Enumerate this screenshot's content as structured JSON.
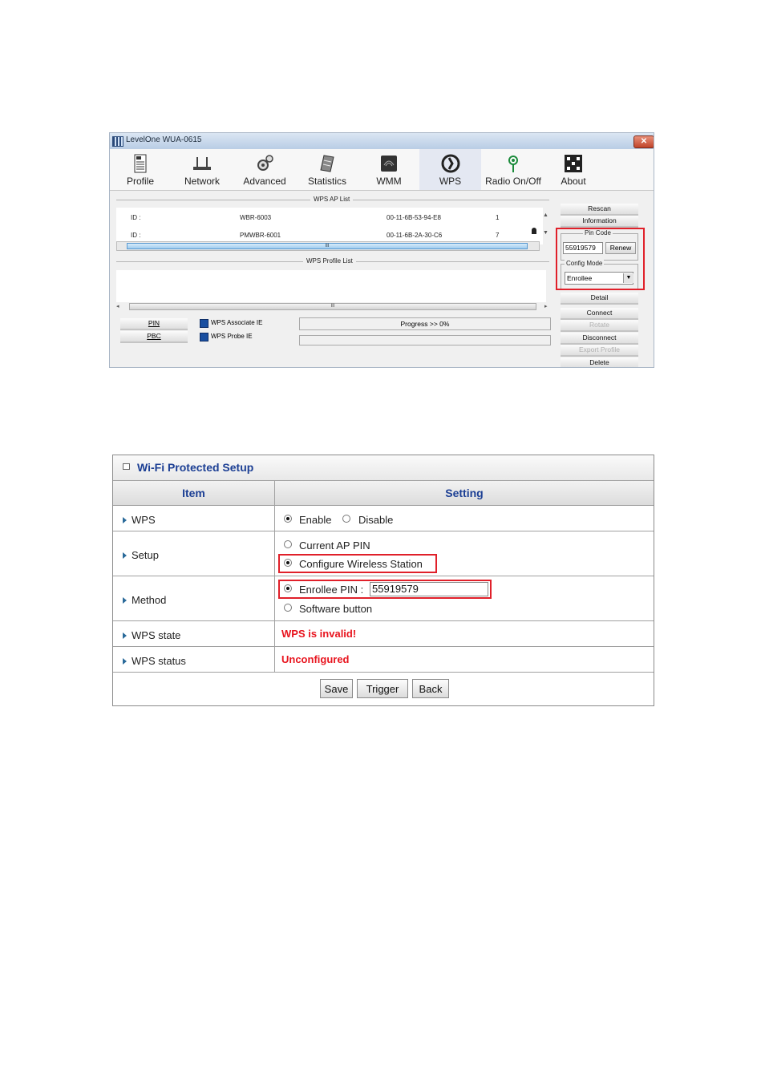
{
  "window": {
    "title": "LevelOne WUA-0615",
    "close_glyph": "✕"
  },
  "toolbar": [
    {
      "label": "Profile",
      "icon": "profile-icon"
    },
    {
      "label": "Network",
      "icon": "network-icon"
    },
    {
      "label": "Advanced",
      "icon": "advanced-icon"
    },
    {
      "label": "Statistics",
      "icon": "statistics-icon"
    },
    {
      "label": "WMM",
      "icon": "wmm-icon"
    },
    {
      "label": "WPS",
      "icon": "wps-icon"
    },
    {
      "label": "Radio On/Off",
      "icon": "radio-icon"
    },
    {
      "label": "About",
      "icon": "about-icon"
    }
  ],
  "ap_list": {
    "section_label": "WPS AP List",
    "rows": [
      {
        "id_label": "ID :",
        "ssid": "WBR-6003",
        "bssid": "00-11-6B-53-94-E8",
        "channel": "1"
      },
      {
        "id_label": "ID :",
        "ssid": "PMWBR-6001",
        "bssid": "00-11-6B-2A-30-C6",
        "channel": "7"
      }
    ],
    "scroll_grip": "III"
  },
  "profile_list": {
    "section_label": "WPS Profile List",
    "scroll_grip": "III"
  },
  "side_buttons": {
    "rescan": "Rescan",
    "information": "Information",
    "detail": "Detail",
    "connect": "Connect",
    "rotate": "Rotate",
    "disconnect": "Disconnect",
    "export_profile": "Export Profile",
    "delete": "Delete"
  },
  "pin_code": {
    "label": "Pin Code",
    "value": "55919579",
    "renew": "Renew"
  },
  "config_mode": {
    "label": "Config Mode",
    "value": "Enrollee"
  },
  "bottom": {
    "pin_button": "PIN",
    "pbc_button": "PBC",
    "associate_ie": "WPS Associate IE",
    "probe_ie": "WPS Probe IE",
    "progress": "Progress >> 0%"
  },
  "wps_form": {
    "title": "Wi-Fi Protected Setup",
    "col_item": "Item",
    "col_setting": "Setting",
    "wps": {
      "label": "WPS",
      "enable": "Enable",
      "disable": "Disable"
    },
    "setup": {
      "label": "Setup",
      "current_ap_pin": "Current AP PIN",
      "configure_station": "Configure Wireless Station"
    },
    "method": {
      "label": "Method",
      "enrollee_pin_label": "Enrollee PIN :",
      "enrollee_pin_value": "55919579",
      "software_button": "Software button"
    },
    "wps_state": {
      "label": "WPS state",
      "value": "WPS is invalid!"
    },
    "wps_status": {
      "label": "WPS status",
      "value": "Unconfigured"
    },
    "buttons": {
      "save": "Save",
      "trigger": "Trigger",
      "back": "Back"
    },
    "colors": {
      "header_text": "#1c3f94",
      "alert_red": "#e8141e",
      "highlight_box": "#e0202a"
    }
  }
}
